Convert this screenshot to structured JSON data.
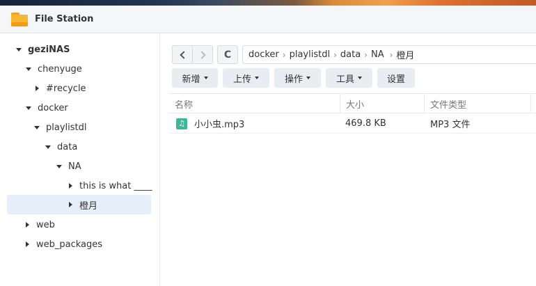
{
  "window": {
    "title": "File Station",
    "app_icon": "folder-icon"
  },
  "sidebar": {
    "root": "geziNAS",
    "items": [
      {
        "label": "chenyuge",
        "expanded": true
      },
      {
        "label": "#recycle",
        "expanded": false
      },
      {
        "label": "docker",
        "expanded": true
      },
      {
        "label": "playlistdl",
        "expanded": true
      },
      {
        "label": "data",
        "expanded": true
      },
      {
        "label": "NA",
        "expanded": true
      },
      {
        "label": "this is what ____",
        "expanded": false
      },
      {
        "label": "橙月",
        "expanded": false,
        "selected": true
      },
      {
        "label": "web",
        "expanded": false
      },
      {
        "label": "web_packages",
        "expanded": false
      }
    ]
  },
  "toolbar": {
    "back_icon": "chevron-left-icon",
    "forward_icon": "chevron-right-icon",
    "refresh_icon": "refresh-icon",
    "refresh_glyph": "C",
    "breadcrumb": [
      "docker",
      "playlistdl",
      "data",
      "NA",
      "橙月"
    ],
    "buttons": {
      "new": "新增",
      "upload": "上传",
      "action": "操作",
      "tools": "工具",
      "settings": "设置"
    }
  },
  "table": {
    "headers": {
      "name": "名称",
      "size": "大小",
      "type": "文件类型"
    },
    "rows": [
      {
        "name": "小小虫.mp3",
        "size": "469.8 KB",
        "type": "MP3 文件",
        "icon": "music-file-icon",
        "icon_glyph": "♫"
      }
    ]
  },
  "colors": {
    "accent": "#3bb79a",
    "selected": "#e4effa",
    "folder": "#f7b733"
  }
}
